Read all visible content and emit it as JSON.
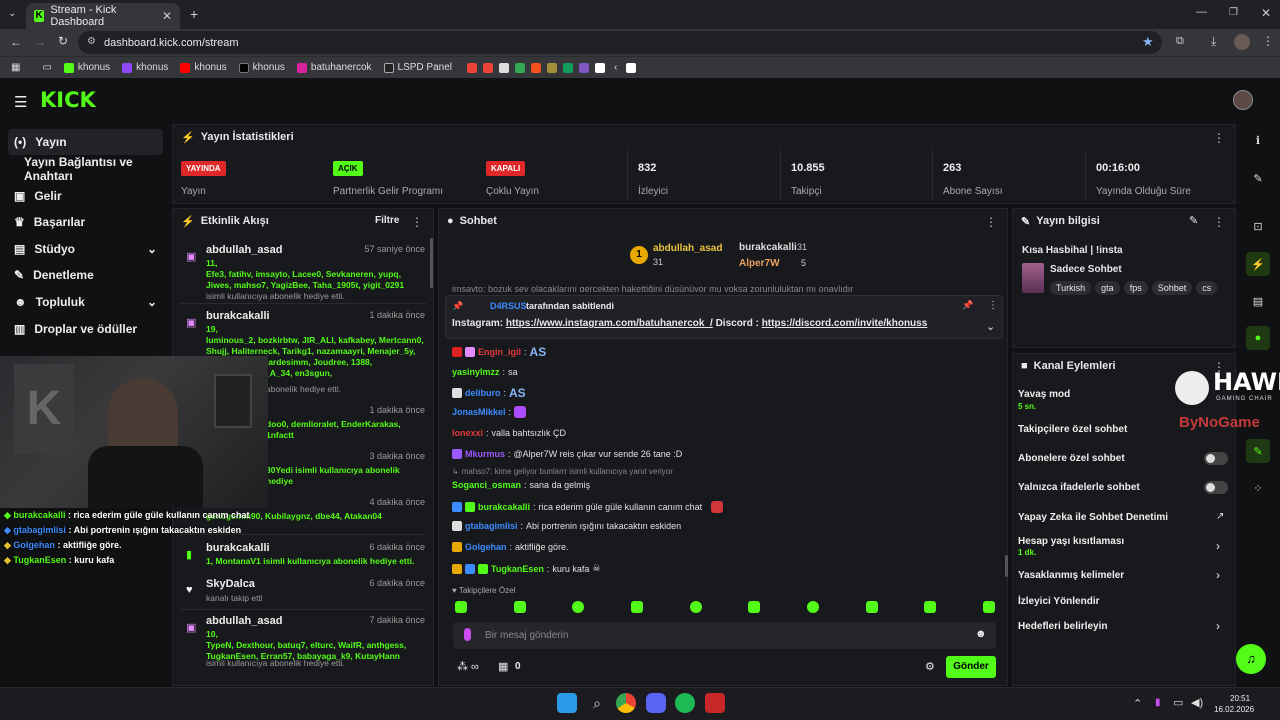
{
  "browser": {
    "tab_title": "Stream - Kick Dashboard",
    "url": "dashboard.kick.com/stream",
    "bookmarks": [
      "khonus",
      "khonus",
      "khonus",
      "khonus",
      "batuhanercok",
      "LSPD Panel"
    ]
  },
  "app": {
    "logo": "KICK"
  },
  "sidebar": {
    "items": [
      {
        "label": "Yayın",
        "icon": "broadcast-icon"
      },
      {
        "label": "Yayın Bağlantısı ve Anahtarı",
        "icon": ""
      },
      {
        "label": "Gelir",
        "icon": "wallet-icon"
      },
      {
        "label": "Başarılar",
        "icon": "trophy-icon"
      },
      {
        "label": "Stüdyo",
        "icon": "studio-icon"
      },
      {
        "label": "Denetleme",
        "icon": "wrench-icon"
      },
      {
        "label": "Topluluk",
        "icon": "people-icon"
      },
      {
        "label": "Droplar ve ödüller",
        "icon": "gift-icon"
      }
    ]
  },
  "stats": {
    "title": "Yayın İstatistikleri",
    "items": [
      {
        "badge": "YAYINDA",
        "label": "Yayın",
        "badge_color": "#e02828"
      },
      {
        "badge": "AÇIK",
        "label": "Partnerlik Gelir Programı",
        "badge_color": "#53fc18"
      },
      {
        "badge": "KAPALI",
        "label": "Çoklu Yayın",
        "badge_color": "#e02828"
      },
      {
        "value": "832",
        "label": "İzleyici"
      },
      {
        "value": "10.855",
        "label": "Takipçi"
      },
      {
        "value": "263",
        "label": "Abone Sayısı"
      },
      {
        "value": "00:16:00",
        "label": "Yayında Olduğu Süre"
      }
    ]
  },
  "feed": {
    "title": "Etkinlik Akışı",
    "filter": "Filtre",
    "items": [
      {
        "name": "abdullah_asad",
        "time": "57 saniye önce",
        "count": "11,",
        "users": "Efe3, fatihv, imsayto, Lacee0, Sevkaneren, yupq, Jiwes, mahso7, YagizBee, Taha_1905t, yigit_0291",
        "sub": "isimli kullanıcıya abonelik hediye etti."
      },
      {
        "name": "burakcakalli",
        "time": "1 dakika önce",
        "count": "19,",
        "users": "luminous_2, bozkirbtw, JIR_ALI, kafkabey, Mertcann0, Shujj, Haliterneck, Tarikg1, nazamaayri, Menajer_5y, osman, Aynenkardesimm, Joudree, 1388, M_U_S_T_A_F_A_34, en3sgun,",
        "sub": "abonelik hediye etti."
      },
      {
        "name": "",
        "time": "1 dakika önce",
        "count": "",
        "users": "doo0, demlioralet, EnderKarakas, 1nfactt",
        "sub": ""
      },
      {
        "name": "",
        "time": "3 dakika önce",
        "count": "",
        "users": "30Yedi isimli kullanıcıya abonelik hediye",
        "sub": ""
      },
      {
        "name": "",
        "time": "4 dakika önce",
        "count": "",
        "users": "gencgemm90, Kubilaygnz, dbe44, Atakan04",
        "sub": ""
      },
      {
        "name": "burakcakalli",
        "time": "6 dakika önce",
        "count": "",
        "users": "1, MontanaV1 isimli kullanıcıya abonelik hediye etti.",
        "sub": ""
      },
      {
        "name": "SkyDalca",
        "time": "6 dakika önce",
        "count": "",
        "users": "",
        "sub": "kanalı takip etti"
      },
      {
        "name": "abdullah_asad",
        "time": "7 dakika önce",
        "count": "10,",
        "users": "TypeN, Dexthour, batuq7, elturc, WaifR, anthgess, TugkanEsen, Erran57, babayaga_k9, KutayHann",
        "sub": "isimli kullanıcıya abonelik hediye etti."
      }
    ]
  },
  "chat": {
    "title": "Sohbet",
    "top_gifters": [
      {
        "rank": "1",
        "name": "abdullah_asad",
        "count": "31"
      },
      {
        "name": "burakcakalli",
        "count": "31"
      },
      {
        "name": "Alper7W",
        "count": "5"
      }
    ],
    "clipped_line": "imsayto: bozuk şey olacaklarını gerçekten hakettiğini düşünüyor mu yoksa zorunluluktan mı onaylıdır",
    "pinned": {
      "by": "D4RSUS",
      "suffix": "tarafından sabitlendi",
      "instagram_label": "Instagram:",
      "instagram": "https://www.instagram.com/batuhanercok_/",
      "discord_label": "Discord :",
      "discord": "https://discord.com/invite/khonuss"
    },
    "messages": [
      {
        "user": "Engin_igil",
        "text": "AS",
        "color": "#e03a3a"
      },
      {
        "user": "yasinylmzz",
        "text": "sa",
        "color": "#53fc18"
      },
      {
        "user": "deliburo",
        "text": "AS",
        "color": "#3b8cff"
      },
      {
        "user": "JonasMikkel",
        "text": "",
        "color": "#3b8cff"
      },
      {
        "user": "lonexxi",
        "text": "valla bahtsızlık ÇD",
        "color": "#e03a3a"
      },
      {
        "user": "Mkurmus",
        "text": "@Alper7W reis çıkar vur sende 26 tane :D",
        "color": "#9b59ff"
      },
      {
        "user": "Soganci_osman",
        "text": "sana da gelmiş",
        "color": "#53fc18",
        "reply": "mahso7: kime geliyor bunlarrr isimli kullanıcıya yanıt veriyor"
      },
      {
        "user": "burakcakalli",
        "text": "rica ederim güle güle kullanın canım chat",
        "color": "#53fc18"
      },
      {
        "user": "gtabagimlisi",
        "text": "Abi portrenin ışığını takacaktın eskiden",
        "color": "#3b8cff"
      },
      {
        "user": "Golgehan",
        "text": "aktifliğe göre.",
        "color": "#3b8cff"
      },
      {
        "user": "TugkanEsen",
        "text": "kuru kafa",
        "color": "#53fc18"
      }
    ],
    "followers_only_label": "Takipçilere Özel",
    "input_placeholder": "Bir mesaj gönderin",
    "points": "0",
    "send_label": "Gönder"
  },
  "overlay_chat": [
    {
      "user": "burakcakalli",
      "text": "rica ederim güle güle kullanın canım chat"
    },
    {
      "user": "gtabagimlisi",
      "text": "Abi portrenin ışığını takacaktın eskiden"
    },
    {
      "user": "Golgehan",
      "text": "aktifliğe göre."
    },
    {
      "user": "TugkanEsen",
      "text": "kuru kafa"
    }
  ],
  "stream_info": {
    "title": "Yayın bilgisi",
    "stream_title": "Kısa Hasbihal | !insta",
    "category": "Sadece Sohbet",
    "tags": [
      "Turkish",
      "gta",
      "fps",
      "Sohbet",
      "cs"
    ]
  },
  "channel_actions": {
    "title": "Kanal Eylemleri",
    "slow_mode": "Yavaş mod",
    "slow_value": "5 sn.",
    "followers_only": "Takipçilere özel sohbet",
    "subs_only": "Abonelere özel sohbet",
    "emotes_only": "Yalnızca ifadelerle sohbet",
    "ai_mod": "Yapay Zeka ile Sohbet Denetimi",
    "account_age": "Hesap yaşı kısıtlaması",
    "account_age_value": "1 dk.",
    "banned_words": "Yasaklanmış kelimeler",
    "redirect": "İzleyici Yönlendir",
    "goals": "Hedefleri belirleyin"
  },
  "overlay_logo": {
    "text": "HAWK",
    "sub": "GAMING CHAIR",
    "partner": "ByNoGame"
  },
  "taskbar": {
    "time": "20:51",
    "date": "16.02.2026"
  }
}
